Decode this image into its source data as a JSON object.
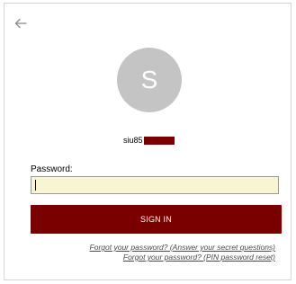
{
  "header": {
    "back_icon": "arrow-left-icon"
  },
  "profile": {
    "avatar_letter": "S",
    "username_visible": "siu85",
    "redaction_color": "#7a0000"
  },
  "form": {
    "password_label": "Password:",
    "password_value": "",
    "signin_label": "SIGN IN",
    "accent_color": "#7a0000",
    "input_bg_color": "#f8f5d4"
  },
  "links": {
    "forgot_secret_questions": "Forgot your password? (Answer your secret questions)",
    "forgot_pin_reset": "Forgot your password? (PIN password reset)"
  }
}
